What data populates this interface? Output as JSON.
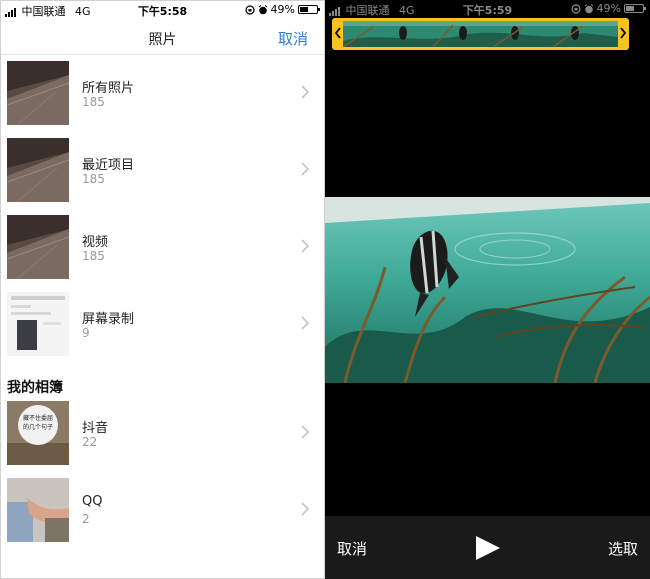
{
  "left_status": {
    "carrier": "中国联通",
    "network": "4G",
    "time": "下午5:58",
    "battery": "49%"
  },
  "right_status": {
    "carrier": "中国联通",
    "network": "4G",
    "time": "下午5:59",
    "battery": "49%"
  },
  "picker": {
    "title": "照片",
    "cancel": "取消",
    "albums": [
      {
        "name": "所有照片",
        "count": "185"
      },
      {
        "name": "最近项目",
        "count": "185"
      },
      {
        "name": "视频",
        "count": "185"
      },
      {
        "name": "屏幕录制",
        "count": "9"
      }
    ],
    "section_title": "我的相簿",
    "my_albums": [
      {
        "name": "抖音",
        "count": "22",
        "thumb_text_line1": "藏不住委屈",
        "thumb_text_line2": "的几个句子"
      },
      {
        "name": "QQ",
        "count": "2"
      }
    ]
  },
  "editor": {
    "cancel": "取消",
    "select": "选取"
  },
  "colors": {
    "accent_blue": "#2a7fe0",
    "scrubber_yellow": "#f7c31f",
    "count_gray": "#999999"
  },
  "icons": {
    "chevron": "chevron-right-icon",
    "play": "play-icon",
    "rotation_lock": "rotation-lock-icon",
    "alarm": "alarm-icon",
    "battery": "battery-icon"
  }
}
